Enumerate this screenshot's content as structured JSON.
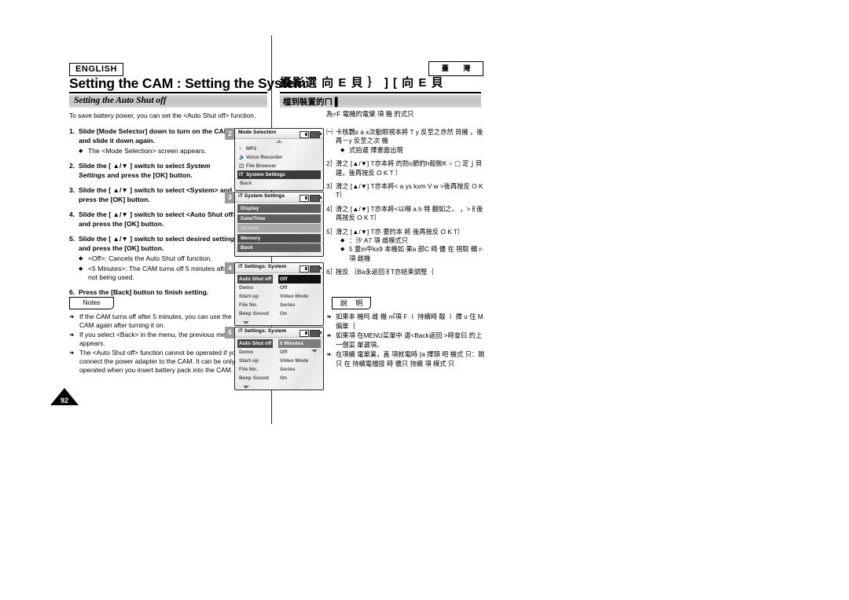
{
  "page": {
    "number": "92",
    "language_badge": "ENGLISH",
    "region_badge": "臺 灣"
  },
  "left": {
    "title": "Setting the CAM : Setting the System",
    "subhead": "Setting the Auto Shut off",
    "intro": "To save battery power, you can set the <Auto Shut off> function.",
    "steps": [
      {
        "num": "1.",
        "text": "Slide [Mode Selector] down to turn on the CAM and slide it down again.",
        "bullets": [
          "The <Mode Selection> screen appears."
        ]
      },
      {
        "num": "2.",
        "text_pre": "Slide the [ ▲/▼ ] switch to select ",
        "text_em": "System Settings",
        "text_post": " and press the [OK] button.",
        "bullets": []
      },
      {
        "num": "3.",
        "text": "Slide the [ ▲/▼ ] switch to select <System> and press the [OK] button.",
        "bullets": []
      },
      {
        "num": "4.",
        "text": "Slide the [ ▲/▼ ] switch to select <Auto Shut off> and press the [OK] button.",
        "bullets": []
      },
      {
        "num": "5.",
        "text": "Slide the [ ▲/▼ ] switch to select desired setting and press the [OK] button.",
        "bullets": [
          "<Off>: Cancels the Auto Shut off function.",
          "<5 Minutes>: The CAM turns off 5 minutes after not being used."
        ]
      },
      {
        "num": "6.",
        "text": "Press the [Back] button to finish setting.",
        "bullets": []
      }
    ],
    "notes_label": "Notes",
    "notes": [
      "If the CAM turns off after 5 minutes, you can use the CAM again after turning it on.",
      "If you select <Back> in the menu, the previous menu appears.",
      "The <Auto Shut off> function cannot be operated if you connect the power adapter to the CAM. It can be only operated when you insert battery pack into the CAM."
    ]
  },
  "right": {
    "title": "攝影選 向 E 貝 ｝ ] [ 向 E 貝",
    "subhead": "檔到裝置的ㄇ ▌",
    "intro": "為<F 電機的電窠 項  機 的式只",
    "steps": [
      {
        "num": "㈠",
        "text": "卡核鸚x a x次動眼視本將 T y 反至之亦然 貝機 ，後再－y 反至之次 機",
        "bullets": [
          "式拍選 擇畫面出現"
        ]
      },
      {
        "num": "2］",
        "text": "滑之 [▲/▼] T亦本將 的防o節的h般胺K ○ ▢ 定ｊ貝建，後再按反 O K T ｝",
        "bullets": []
      },
      {
        "num": "3］",
        "text": "滑之 [▲/▼] T亦本將< a ys kxm V w >後再按反 O K T｝",
        "bullets": []
      },
      {
        "num": "4］",
        "text": "滑之 [▲/▼] T亦本將<以噸 a h 特 翻如之。  ，>ㅐ後再按反 O K T｝",
        "bullets": []
      },
      {
        "num": "5］",
        "text": "滑之 [▲/▼] T亦 要的本 將 後再按反 O K T｝",
        "bullets": [
          "：沙 A7 項  雌模式只",
          "5 量in中kx9 本機如 果a 部C 時 儘 在 視取 輯 r-項   雌機"
        ]
      },
      {
        "num": "6］",
        "text": "按反 ｛Ba永返回ㅐT亦結束調整｛",
        "bullets": []
      }
    ],
    "notes_label": "說 明",
    "notes": [
      "如果本 機吗  雌 機 ㎡項 F ｉ 持續時 酸 ｉ 擇 u 住 M偏單｛",
      "如果項 在MENU菜單中 選<Back返回 >時會曰 的上 一個菜 單選項。",
      "在項續 電單業，直 項就電時 {a 擇頭 吧  機式 只：跳只 在 持續電檔接 時 儘只 持續 項   模式 只"
    ]
  },
  "lcd_screens": [
    {
      "step": "2",
      "title": "Mode Selection",
      "title_icon": "",
      "icons": [
        "card-icon",
        "battery-icon"
      ],
      "arrow_up": true,
      "arrow_down": false,
      "type": "icon-list",
      "rows": [
        {
          "icon": "♪",
          "label": "MP3",
          "selected": false
        },
        {
          "icon": "♉",
          "label": "Voice Recorder",
          "selected": false
        },
        {
          "icon": "☰",
          "label": "File Browser",
          "selected": false
        },
        {
          "icon": "iT",
          "label": "System Settings",
          "selected": true
        },
        {
          "icon": "",
          "label": "Back",
          "selected": false,
          "plain": true
        }
      ]
    },
    {
      "step": "3",
      "title": "System Settings",
      "title_icon": "iT",
      "icons": [
        "card-icon",
        "battery-icon"
      ],
      "arrow_up": false,
      "arrow_down": false,
      "type": "pill-list",
      "rows": [
        {
          "label": "Display",
          "state": "normal"
        },
        {
          "label": "Date/Time",
          "state": "normal"
        },
        {
          "label": "System",
          "state": "dim"
        },
        {
          "label": "Memory",
          "state": "hot"
        },
        {
          "label": "Back",
          "state": "normal"
        }
      ]
    },
    {
      "step": "4",
      "title": "Settings: System",
      "title_icon": "iT",
      "icons": [
        "card-icon",
        "battery-icon"
      ],
      "arrow_up": false,
      "arrow_down": true,
      "type": "kv-list",
      "rows": [
        {
          "key": "Auto Shut off",
          "value": "Off",
          "selected": true
        },
        {
          "key": "Demo",
          "value": "Off",
          "selected": false
        },
        {
          "key": "Start-up",
          "value": "Video Mode",
          "selected": false
        },
        {
          "key": "File No.",
          "value": "Series",
          "selected": false
        },
        {
          "key": "Beep Sound",
          "value": "On",
          "selected": false
        }
      ]
    },
    {
      "step": "5",
      "title": "Settings: System",
      "title_icon": "iT",
      "icons": [
        "card-icon",
        "battery-icon"
      ],
      "arrow_up": false,
      "arrow_down": true,
      "type": "kv-list",
      "rows": [
        {
          "key": "Auto Shut off",
          "value": "5 Minutes",
          "selected": true,
          "value_grey": true
        },
        {
          "key": "Demo",
          "value": "Off",
          "selected": false
        },
        {
          "key": "Start-up",
          "value": "Video Mode",
          "selected": false
        },
        {
          "key": "File No.",
          "value": "Series",
          "selected": false
        },
        {
          "key": "Beep Sound",
          "value": "On",
          "selected": false
        }
      ]
    }
  ]
}
